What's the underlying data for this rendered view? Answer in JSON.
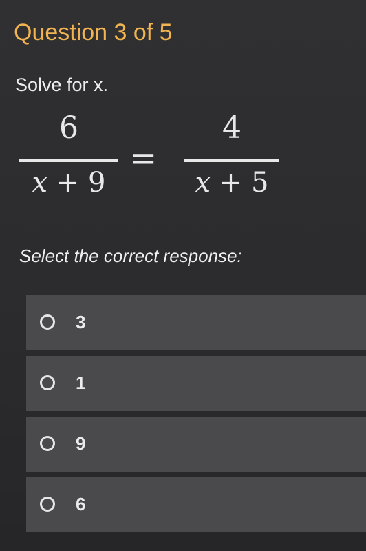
{
  "header": {
    "title": "Question 3 of 5"
  },
  "question": {
    "prompt": "Solve for x.",
    "equation": {
      "left": {
        "numerator": "6",
        "denominator_var": "x",
        "denominator_rest": " + 9"
      },
      "equals": "=",
      "right": {
        "numerator": "4",
        "denominator_var": "x",
        "denominator_rest": " + 5"
      }
    },
    "instruction": "Select the correct response:"
  },
  "options": [
    {
      "label": "3",
      "selected": false
    },
    {
      "label": "1",
      "selected": false
    },
    {
      "label": "9",
      "selected": false
    },
    {
      "label": "6",
      "selected": false
    }
  ],
  "colors": {
    "title": "#f2b450",
    "background": "#2e2e30",
    "option_background": "#4a4a4c"
  }
}
